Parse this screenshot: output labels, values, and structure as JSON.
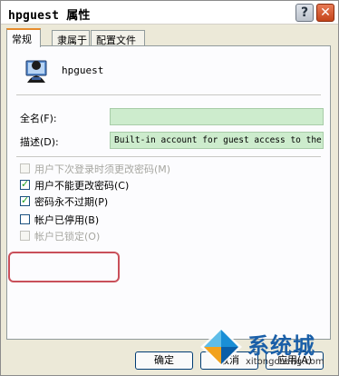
{
  "window": {
    "title": "hpguest 属性",
    "help_glyph": "?",
    "close_glyph": "✕"
  },
  "tabs": [
    "常规",
    "隶属于",
    "配置文件"
  ],
  "user": {
    "name": "hpguest",
    "icon": "user-account-icon"
  },
  "fields": {
    "fullname_label": "全名(F):",
    "fullname_value": "",
    "description_label": "描述(D):",
    "description_value": "Built-in account for guest access to the"
  },
  "checkboxes": [
    {
      "label": "用户下次登录时须更改密码(M)",
      "checked": false,
      "enabled": false
    },
    {
      "label": "用户不能更改密码(C)",
      "checked": true,
      "enabled": true
    },
    {
      "label": "密码永不过期(P)",
      "checked": true,
      "enabled": true
    },
    {
      "label": "帐户已停用(B)",
      "checked": false,
      "enabled": true
    },
    {
      "label": "帐户已锁定(O)",
      "checked": false,
      "enabled": false
    }
  ],
  "buttons": {
    "ok": "确定",
    "cancel": "取消",
    "apply": "应用(A)"
  },
  "watermark": {
    "text": "系统城",
    "url": "xitongcheng.com"
  },
  "colors": {
    "title_bar": "#ffffff",
    "dialog_bg": "#ece9d8",
    "field_bg": "#cdeccd",
    "highlight_border": "#c9505a",
    "active_tab_accent": "#e68b2c",
    "watermark_blue": "#1a5fa8"
  }
}
